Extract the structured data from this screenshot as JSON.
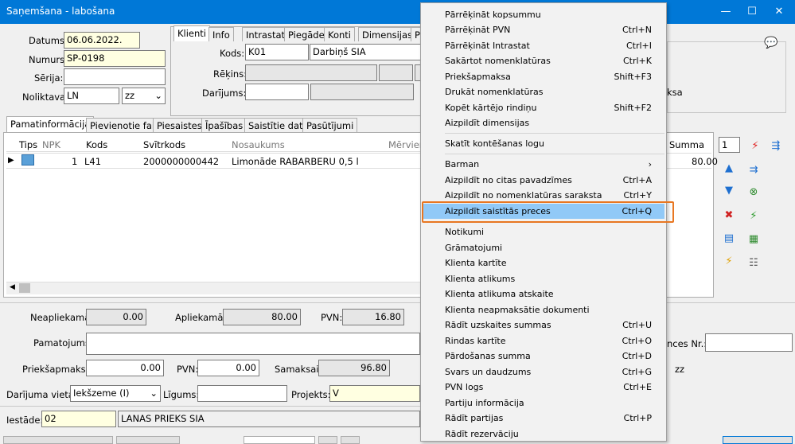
{
  "window": {
    "title": "Saņemšana - labošana",
    "btn_min": "—",
    "btn_max": "☐",
    "btn_close": "✕"
  },
  "header": {
    "datums_label": "Datums:",
    "datums_value": "06.06.2022.",
    "numurs_label": "Numurs:",
    "numurs_value": "SP-0198",
    "serija_label": "Sērija:",
    "serija_value": "",
    "noliktava_label": "Noliktava:",
    "noliktava_value": "LN",
    "noliktava_sub": "zz"
  },
  "client_tabs": [
    "Klienti",
    "Info",
    "Intrastat",
    "Piegāde",
    "Konti",
    "Dimensijas",
    "P"
  ],
  "client": {
    "kods_label": "Kods:",
    "kods_value": "K01",
    "kods_name": "Darbiņš SIA",
    "rekins_label": "Rēķins:",
    "darijums_label": "Darījums:"
  },
  "right_text": "ksa",
  "main_tabs": [
    "Pamatinformācija",
    "Pievienotie faili",
    "Piesaistes",
    "Īpašības",
    "Saistītie dati",
    "Pasūtījumi"
  ],
  "grid": {
    "columns": [
      "Tips",
      "NPK",
      "Kods",
      "Svītrkods",
      "Nosaukums",
      "Mērvien"
    ],
    "summa_col": "Summa",
    "rows": [
      {
        "npk": "1",
        "kods": "L41",
        "svitrkods": "2000000000442",
        "nosaukums": "Limonāde RABARBERU 0,5 l",
        "summa": "80.00"
      }
    ]
  },
  "toolbar": {
    "counter": "1"
  },
  "totals": {
    "neapliekama_label": "Neapliekamā:",
    "neapliekama_value": "0.00",
    "apliekama_label": "Apliekamā:",
    "apliekama_value": "80.00",
    "pvn_label": "PVN:",
    "pvn_value": "16.80",
    "pamatojums_label": "Pamatojums:",
    "ences_label": "nces Nr.:",
    "priekssapmaksa_label": "Priekšapmaksa:",
    "priekssapmaksa_value": "0.00",
    "pvn2_label": "PVN:",
    "pvn2_value": "0.00",
    "samaksai_label": "Samaksai:",
    "samaksai_value": "96.80",
    "zz": "zz",
    "darijuma_vieta_label": "Darījuma vieta:",
    "darijuma_vieta_value": "Iekšzeme (I)",
    "ligums_label": "Līgums:",
    "projekts_label": "Projekts:",
    "projekts_value": "V",
    "iestade_label": "Iestāde:",
    "iestade_value": "02",
    "iestade_name": "LANAS PRIEKS SIA"
  },
  "context_menu": [
    {
      "label": "Pārrēķināt kopsummu",
      "shortcut": ""
    },
    {
      "label": "Pārrēķināt PVN",
      "shortcut": "Ctrl+N"
    },
    {
      "label": "Pārrēķināt Intrastat",
      "shortcut": "Ctrl+I"
    },
    {
      "label": "Sakārtot nomenklatūras",
      "shortcut": "Ctrl+K"
    },
    {
      "label": "Priekšapmaksa",
      "shortcut": "Shift+F3"
    },
    {
      "label": "Drukāt nomenklatūras",
      "shortcut": ""
    },
    {
      "label": "Kopēt kārtējo rindiņu",
      "shortcut": "Shift+F2"
    },
    {
      "label": "Aizpildīt dimensijas",
      "shortcut": ""
    },
    {
      "label": "Skatīt kontēšanas logu",
      "shortcut": ""
    },
    {
      "label": "Barman",
      "shortcut": "›"
    },
    {
      "label": "Aizpildīt no citas pavadzīmes",
      "shortcut": "Ctrl+A"
    },
    {
      "label": "Aizpildīt no nomenklatūras saraksta",
      "shortcut": "Ctrl+Y"
    },
    {
      "label": "Aizpildīt saistītās preces",
      "shortcut": "Ctrl+Q"
    },
    {
      "label": "Notikumi",
      "shortcut": ""
    },
    {
      "label": "Grāmatojumi",
      "shortcut": ""
    },
    {
      "label": "Klienta kartīte",
      "shortcut": ""
    },
    {
      "label": "Klienta atlikums",
      "shortcut": ""
    },
    {
      "label": "Klienta atlikuma atskaite",
      "shortcut": ""
    },
    {
      "label": "Klienta neapmaksātie dokumenti",
      "shortcut": ""
    },
    {
      "label": "Rādīt uzskaites summas",
      "shortcut": "Ctrl+U"
    },
    {
      "label": "Rindas kartīte",
      "shortcut": "Ctrl+O"
    },
    {
      "label": "Pārdošanas summa",
      "shortcut": "Ctrl+D"
    },
    {
      "label": "Svars un daudzums",
      "shortcut": "Ctrl+G"
    },
    {
      "label": "PVN logs",
      "shortcut": "Ctrl+E"
    },
    {
      "label": "Partiju informācija",
      "shortcut": ""
    },
    {
      "label": "Rādīt partijas",
      "shortcut": "Ctrl+P"
    },
    {
      "label": "Rādīt rezervāciju",
      "shortcut": ""
    }
  ]
}
